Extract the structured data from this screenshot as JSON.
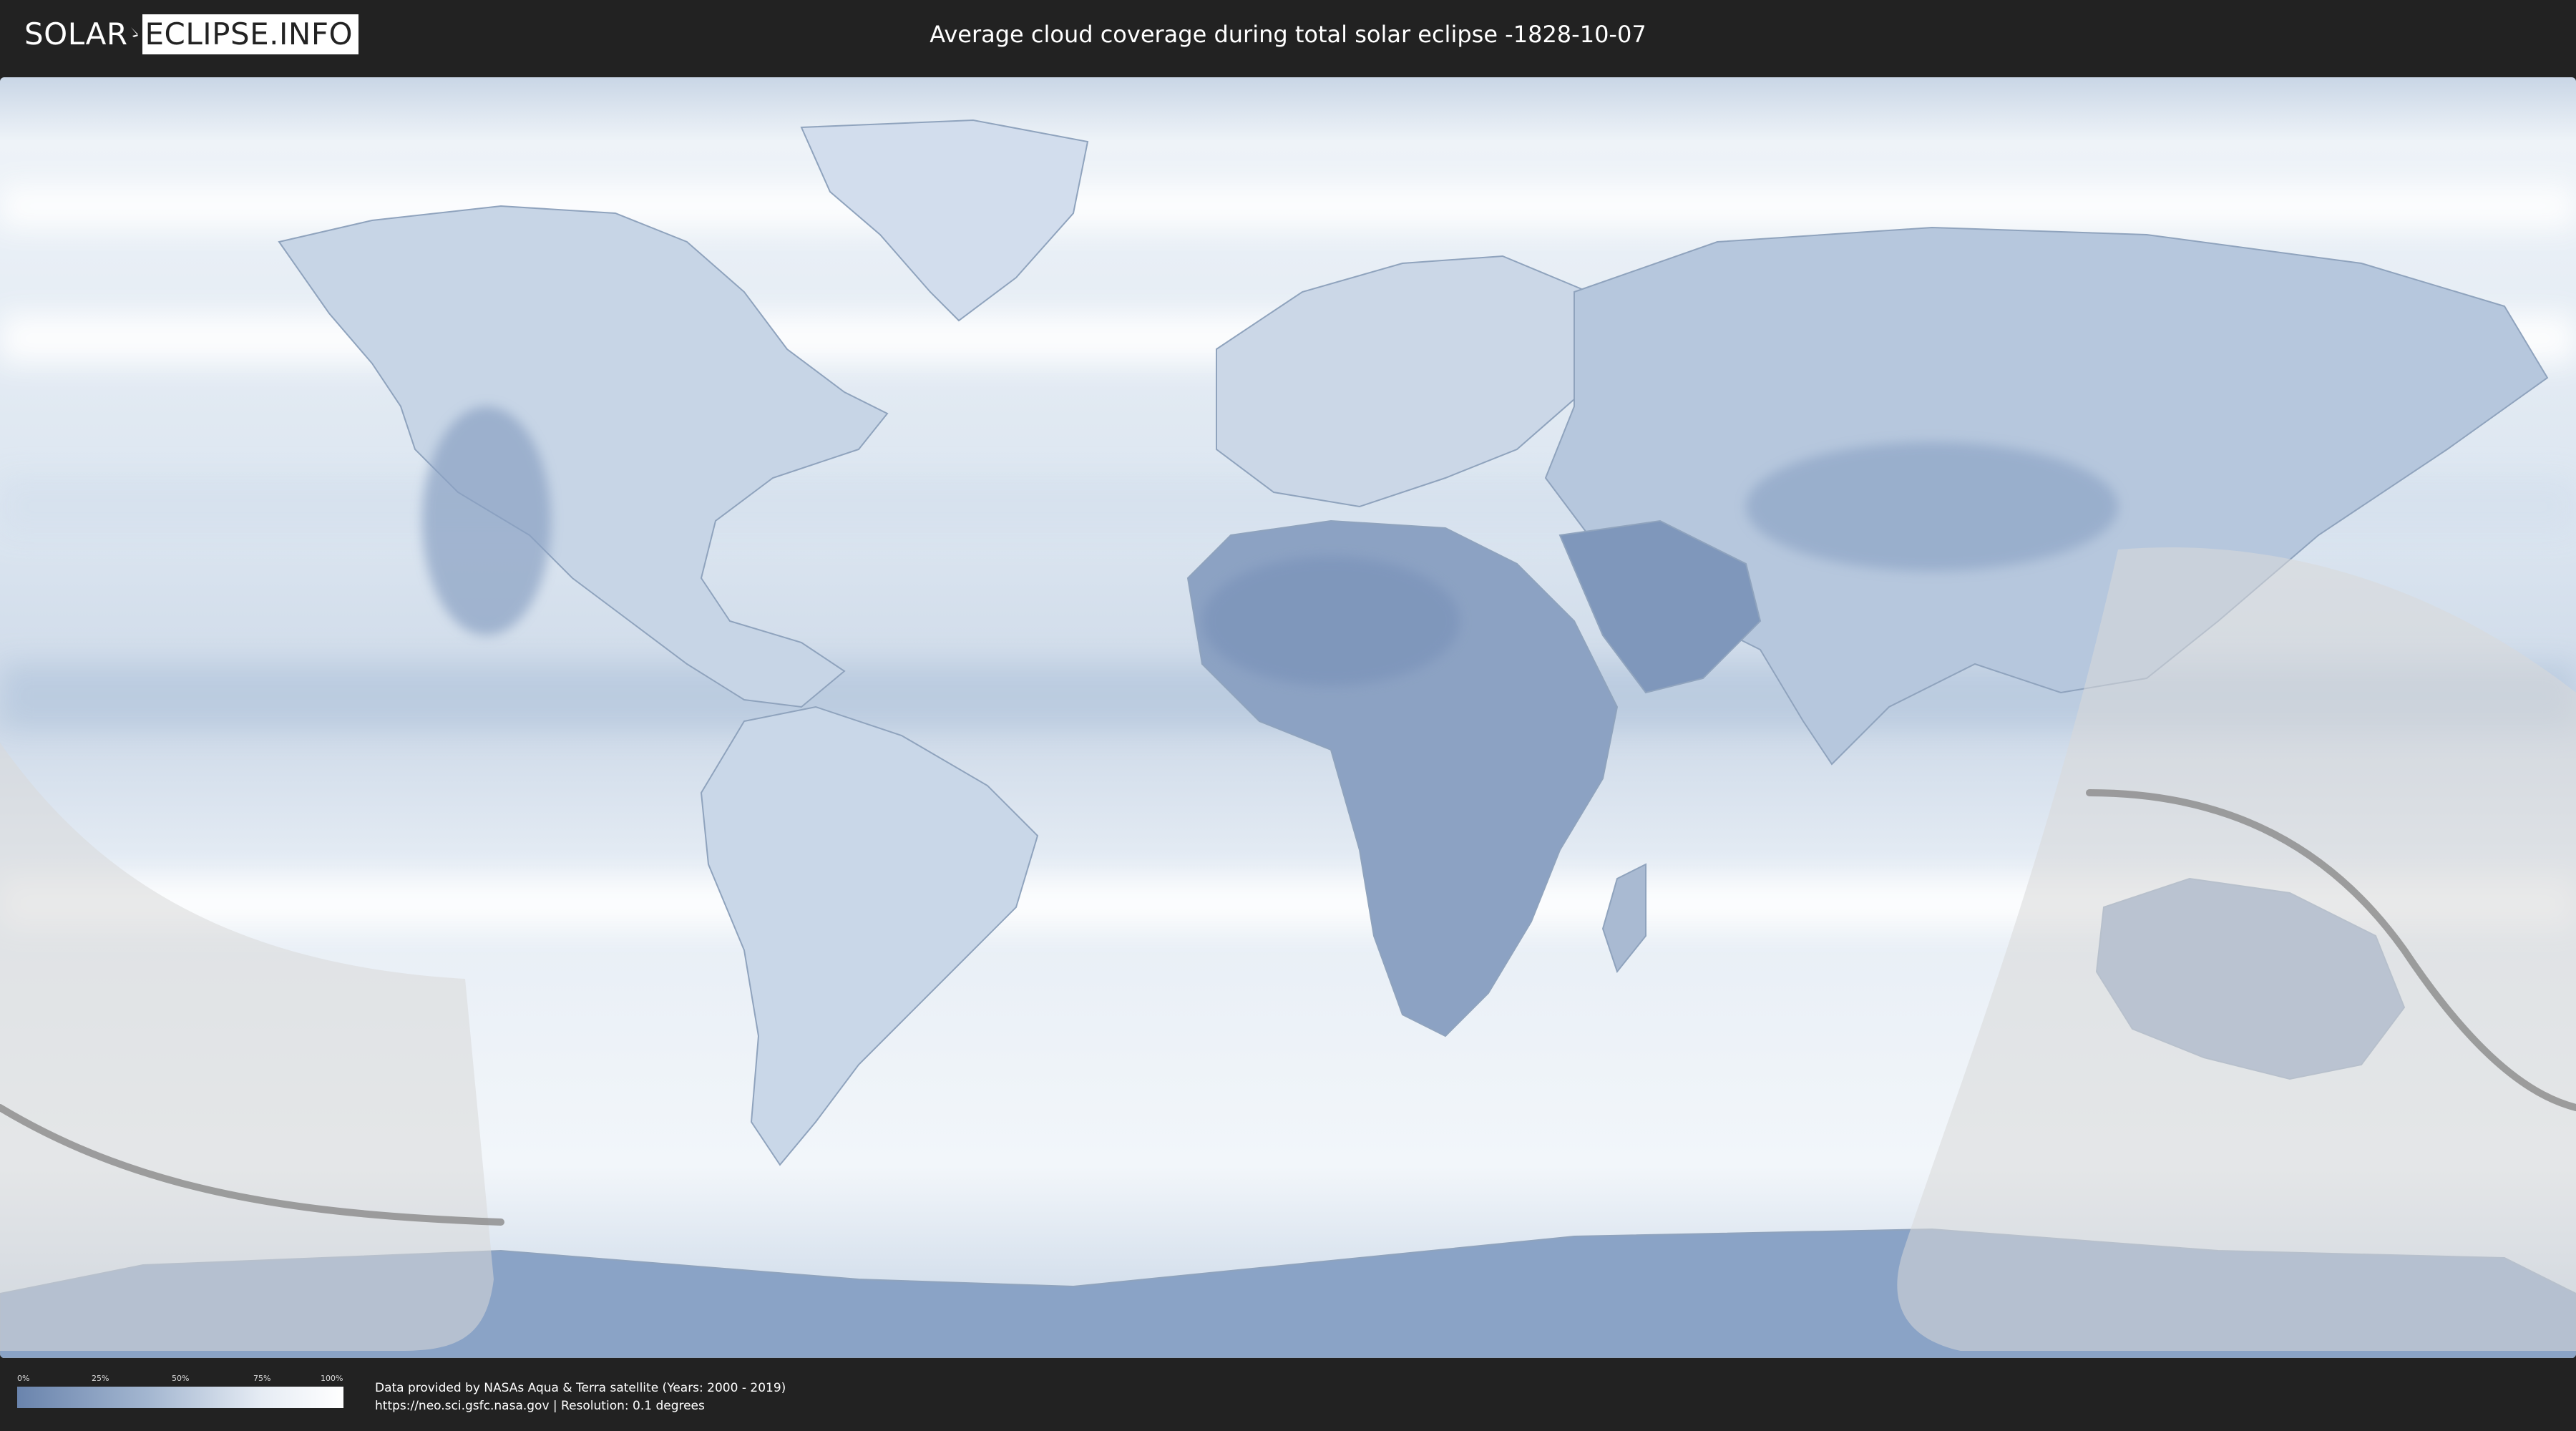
{
  "header": {
    "logo_left": "SOLAR",
    "logo_right": "ECLIPSE.INFO",
    "title": "Average cloud coverage during total solar eclipse -1828-10-07"
  },
  "map": {
    "ocean_color": "#dfe8f2",
    "dense_cloud_color": "#ffffff",
    "clear_sky_color": "#6a84ad",
    "shadow_overlay_color": "#d8d8d8",
    "path_line_color": "#8a8a8a"
  },
  "legend": {
    "ticks": [
      "0%",
      "25%",
      "50%",
      "75%",
      "100%"
    ],
    "gradient_start": "#6a84ad",
    "gradient_end": "#ffffff"
  },
  "footer": {
    "credit_line_1": "Data provided by NASAs Aqua & Terra satellite (Years: 2000 - 2019)",
    "credit_line_2": "https://neo.sci.gsfc.nasa.gov | Resolution: 0.1 degrees"
  }
}
